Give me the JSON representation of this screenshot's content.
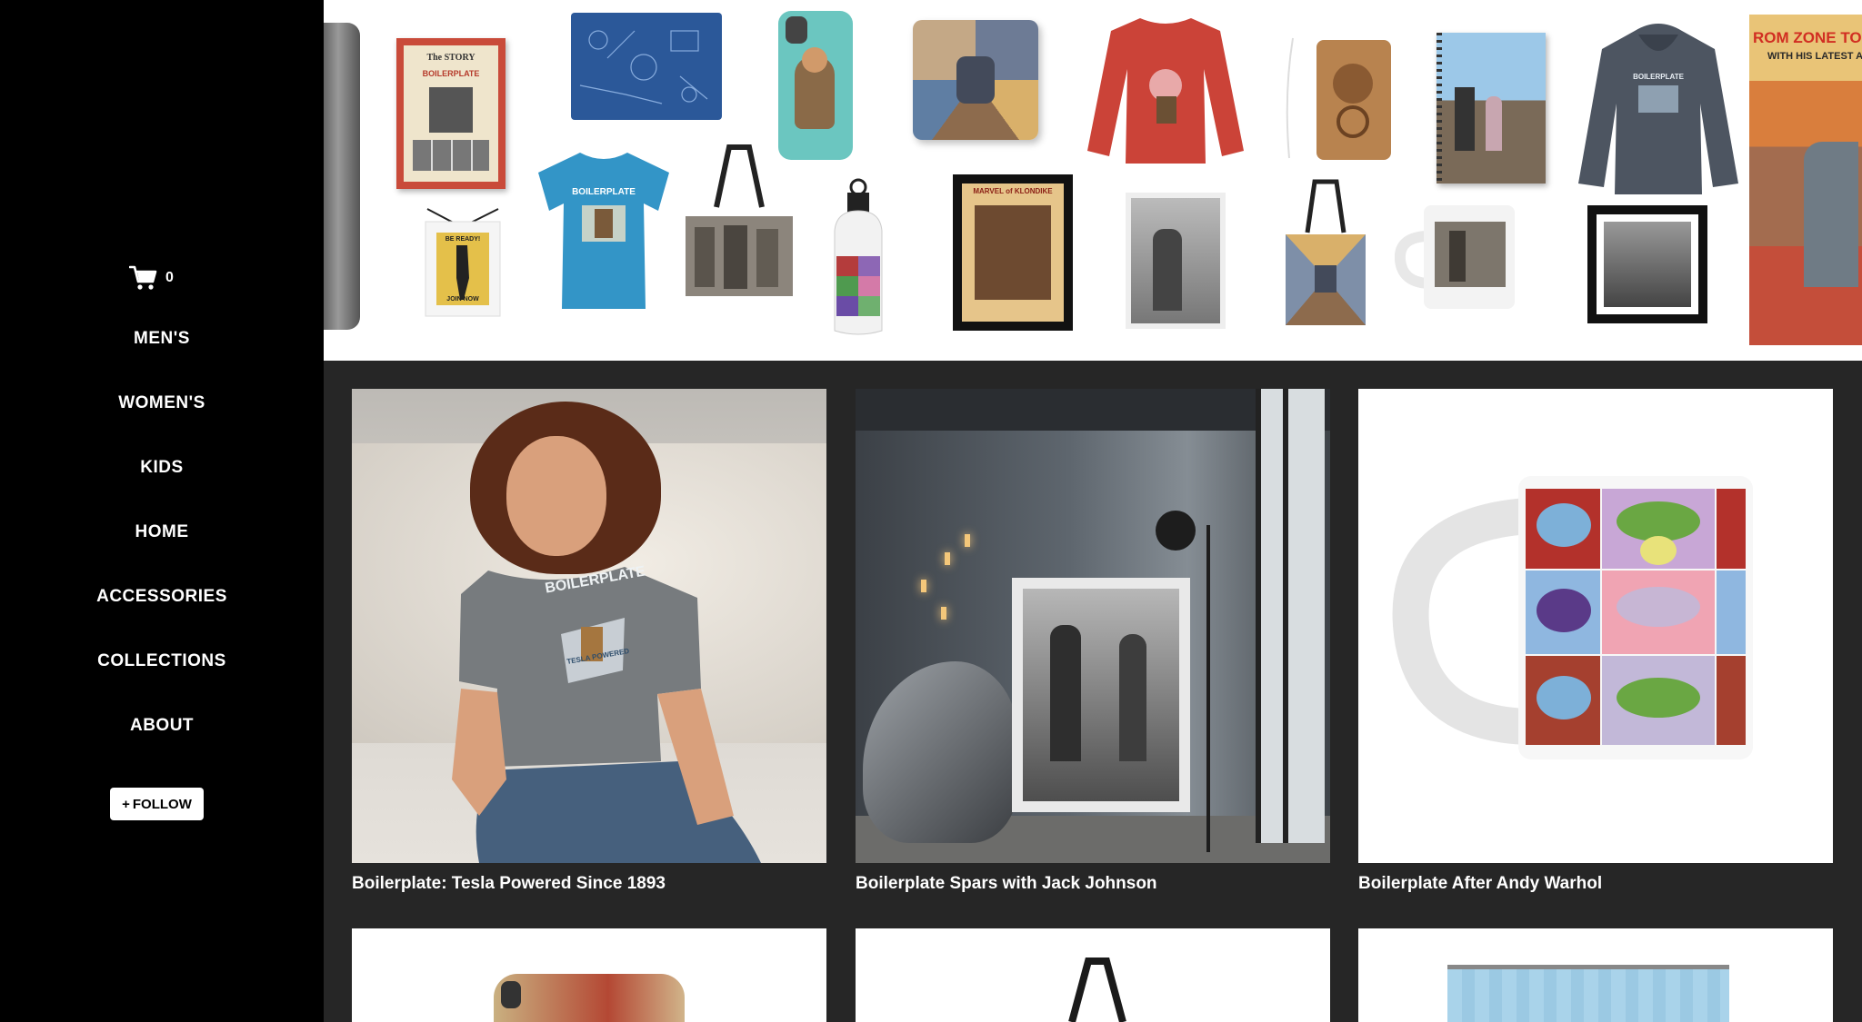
{
  "sidebar": {
    "cart": {
      "icon": "cart-icon",
      "count": "0"
    },
    "nav": [
      {
        "label": "MEN'S"
      },
      {
        "label": "WOMEN'S"
      },
      {
        "label": "KIDS"
      },
      {
        "label": "HOME"
      },
      {
        "label": "ACCESSORIES"
      },
      {
        "label": "COLLECTIONS"
      },
      {
        "label": "ABOUT"
      }
    ],
    "follow": {
      "icon": "plus-icon",
      "plus": "+",
      "label": "FOLLOW"
    }
  },
  "banner": {
    "book": {
      "line1": "The STORY",
      "line2": "BOILERPLATE"
    },
    "tshirt": {
      "text": "BOILERPLATE"
    },
    "drawstring": {
      "line1": "BE READY!",
      "line2": "JOIN NOW"
    },
    "hoodie": {
      "text": "BOILERPLATE"
    },
    "poster": {
      "text": "MARVEL of KLONDIKE"
    },
    "comic": {
      "text": "ROM ZONE TO ZO",
      "sub": "WITH HIS LATEST AIR-S"
    }
  },
  "products": [
    {
      "title": "Boilerplate: Tesla Powered Since 1893",
      "shirt_text": "BOILERPLATE",
      "badge": "TESLA POWERED"
    },
    {
      "title": "Boilerplate Spars with Jack Johnson"
    },
    {
      "title": "Boilerplate After Andy Warhol"
    }
  ],
  "colors": {
    "sidebar_bg": "#000000",
    "page_bg": "#262626",
    "banner_bg": "#ffffff",
    "text": "#ffffff"
  }
}
